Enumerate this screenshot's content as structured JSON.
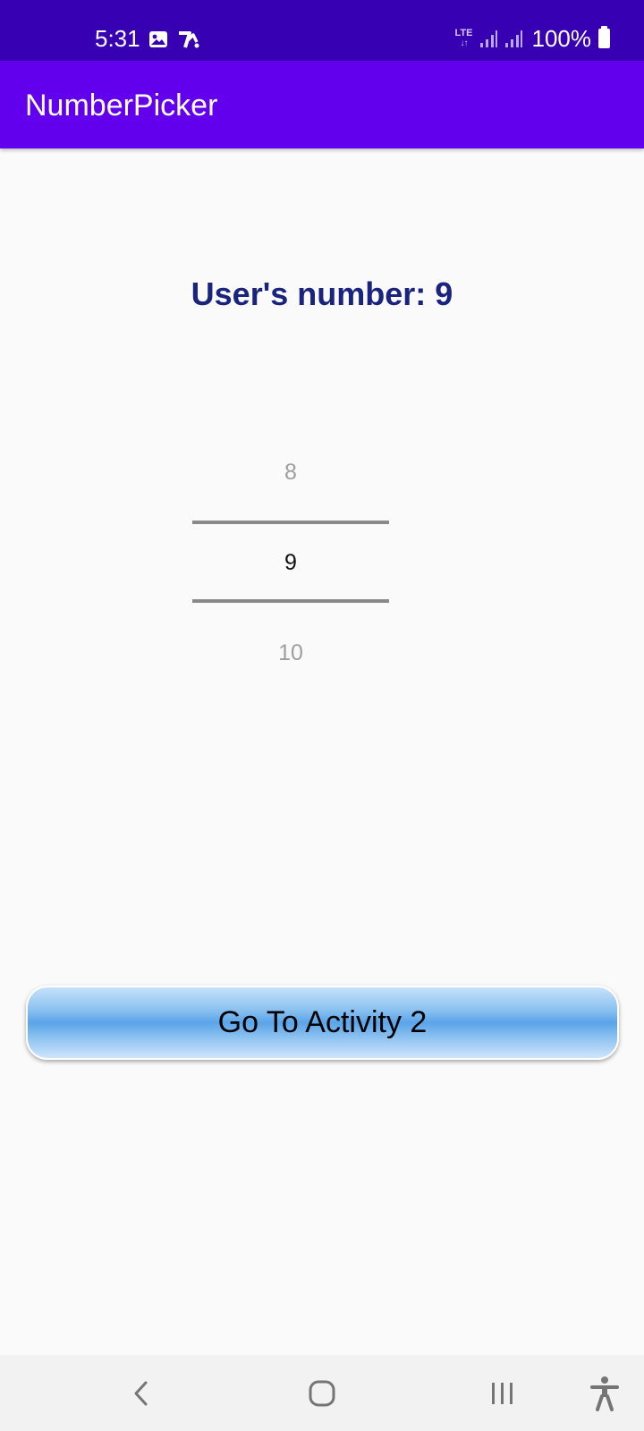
{
  "status_bar": {
    "time": "5:31",
    "network": "LTE",
    "battery": "100%",
    "icons_left": [
      "image-icon",
      "app-notification-icon"
    ],
    "icons_right": [
      "lte-icon",
      "signal-icon",
      "signal-icon",
      "battery-icon"
    ]
  },
  "app_bar": {
    "title": "NumberPicker"
  },
  "main": {
    "users_number_label": "User's number: 9",
    "picker": {
      "prev": "8",
      "current": "9",
      "next": "10"
    },
    "button_label": "Go To Activity 2"
  },
  "nav_bar": {
    "icons": [
      "back-icon",
      "home-icon",
      "recents-icon",
      "accessibility-icon"
    ]
  },
  "colors": {
    "status_bar": "#3700b3",
    "app_bar": "#6200ee",
    "label_text": "#1a237e",
    "button_mid": "#5aa4e9",
    "background": "#fafafa"
  }
}
